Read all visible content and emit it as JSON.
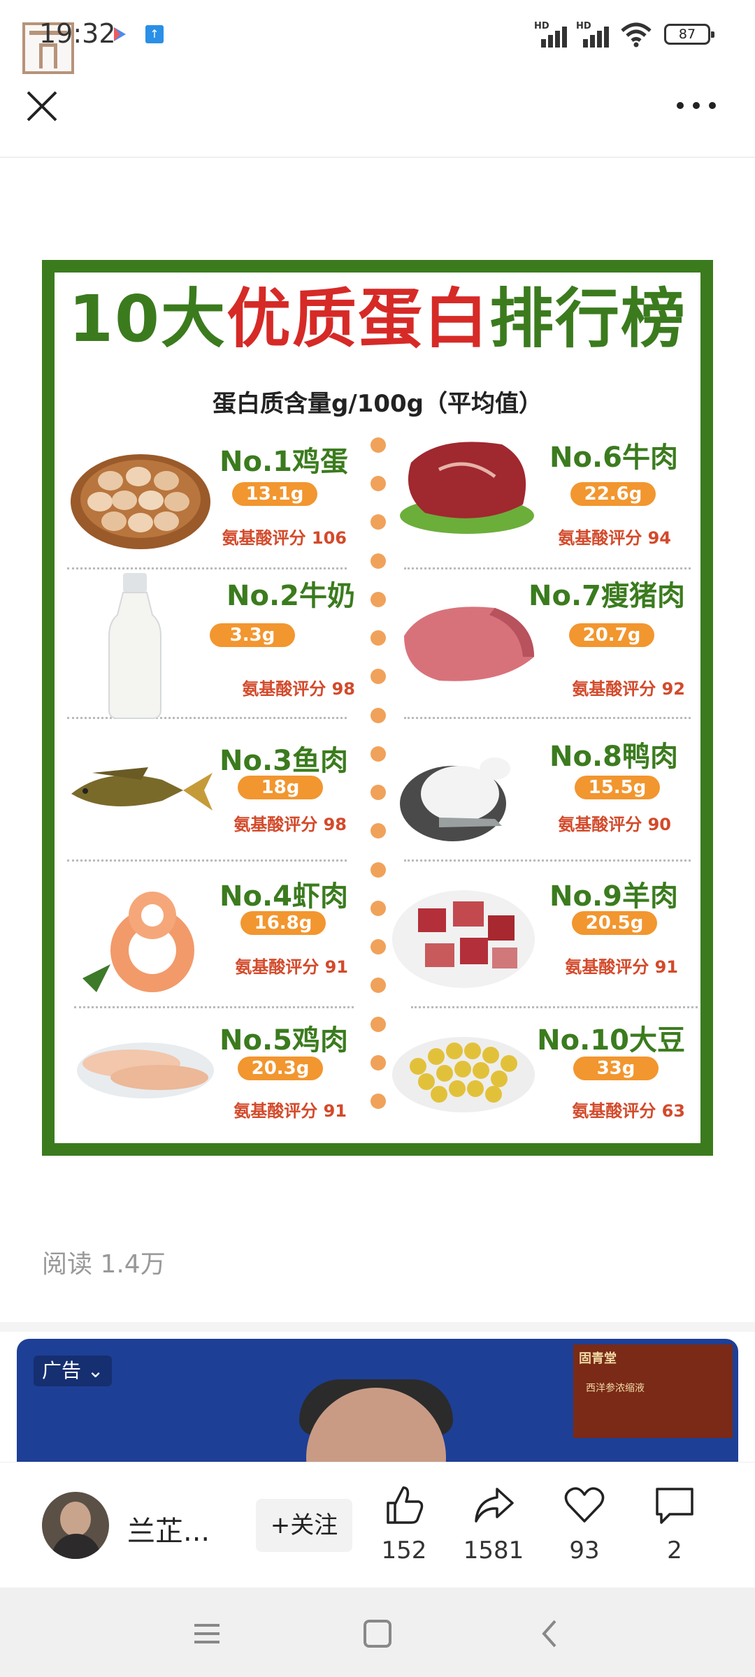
{
  "status_bar": {
    "time": "19:32",
    "battery": "87",
    "signal_1_label": "HD",
    "signal_2_label": "HD"
  },
  "article": {
    "read_count": "阅读 1.4万"
  },
  "infographic": {
    "title_part1": "10大",
    "title_part2": "优质蛋白",
    "title_part3": "排行榜",
    "subtitle": "蛋白质含量g/100g（平均值）",
    "foods": [
      {
        "rank": "No.1鸡蛋",
        "protein": "13.1g",
        "score": "氨基酸评分 106"
      },
      {
        "rank": "No.2牛奶",
        "protein": "3.3g",
        "score": "氨基酸评分 98"
      },
      {
        "rank": "No.3鱼肉",
        "protein": "18g",
        "score": "氨基酸评分 98"
      },
      {
        "rank": "No.4虾肉",
        "protein": "16.8g",
        "score": "氨基酸评分 91"
      },
      {
        "rank": "No.5鸡肉",
        "protein": "20.3g",
        "score": "氨基酸评分 91"
      },
      {
        "rank": "No.6牛肉",
        "protein": "22.6g",
        "score": "氨基酸评分 94"
      },
      {
        "rank": "No.7瘦猪肉",
        "protein": "20.7g",
        "score": "氨基酸评分 92"
      },
      {
        "rank": "No.8鸭肉",
        "protein": "15.5g",
        "score": "氨基酸评分 90"
      },
      {
        "rank": "No.9羊肉",
        "protein": "20.5g",
        "score": "氨基酸评分 91"
      },
      {
        "rank": "No.10大豆",
        "protein": "33g",
        "score": "氨基酸评分 63"
      }
    ]
  },
  "ad": {
    "badge": "广告",
    "brand": "固青堂",
    "product": "西洋参浓缩液"
  },
  "action_bar": {
    "author_name": "兰芷...",
    "follow_label": "+关注",
    "like_count": "152",
    "share_count": "1581",
    "favorite_count": "93",
    "comment_count": "2"
  },
  "colors": {
    "frame_green": "#3b7b1e",
    "title_red": "#d62a27",
    "pill_orange": "#f2962f",
    "ad_blue": "#1d3f96"
  },
  "icons": {
    "close": "close-icon",
    "more": "more-icon",
    "like": "thumbs-up-icon",
    "share": "share-icon",
    "favorite": "heart-icon",
    "comment": "comment-icon",
    "nav_menu": "menu-icon",
    "nav_home": "home-icon",
    "nav_back": "back-icon"
  }
}
